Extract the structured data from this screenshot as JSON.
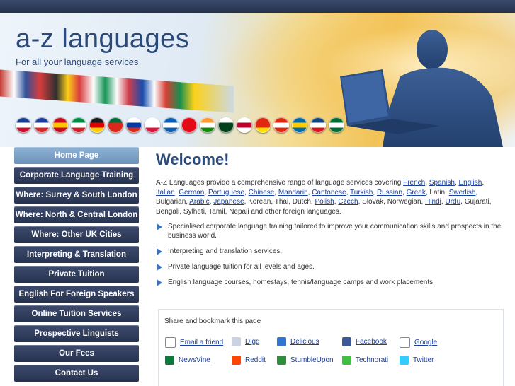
{
  "brand": {
    "title": "a-z languages",
    "tagline": "For all your language services"
  },
  "flags": [
    {
      "name": "uk-flag-icon",
      "colors": [
        "#1a3f8f",
        "#ffffff",
        "#c8102e"
      ]
    },
    {
      "name": "france-flag-icon",
      "colors": [
        "#1f3c99",
        "#ffffff",
        "#d62828"
      ]
    },
    {
      "name": "spain-flag-icon",
      "colors": [
        "#c60b1e",
        "#ffc400",
        "#c60b1e"
      ]
    },
    {
      "name": "italy-flag-icon",
      "colors": [
        "#008c45",
        "#ffffff",
        "#cd212a"
      ]
    },
    {
      "name": "germany-flag-icon",
      "colors": [
        "#1a1a1a",
        "#dd0000",
        "#ffce00"
      ]
    },
    {
      "name": "portugal-flag-icon",
      "colors": [
        "#046a38",
        "#da291c",
        "#da291c"
      ]
    },
    {
      "name": "russia-flag-icon",
      "colors": [
        "#ffffff",
        "#0039a6",
        "#d52b1e"
      ]
    },
    {
      "name": "poland-flag-icon",
      "colors": [
        "#ffffff",
        "#ffffff",
        "#dc143c"
      ]
    },
    {
      "name": "greece-flag-icon",
      "colors": [
        "#0d5eaf",
        "#ffffff",
        "#0d5eaf"
      ]
    },
    {
      "name": "turkey-flag-icon",
      "colors": [
        "#e30a17",
        "#e30a17",
        "#e30a17"
      ]
    },
    {
      "name": "india-flag-icon",
      "colors": [
        "#ff9933",
        "#ffffff",
        "#138808"
      ]
    },
    {
      "name": "pakistan-flag-icon",
      "colors": [
        "#ffffff",
        "#01411c",
        "#01411c"
      ]
    },
    {
      "name": "japan-flag-icon",
      "colors": [
        "#ffffff",
        "#bc002d",
        "#ffffff"
      ]
    },
    {
      "name": "china-flag-icon",
      "colors": [
        "#de2910",
        "#de2910",
        "#ffde00"
      ]
    },
    {
      "name": "hong-kong-flag-icon",
      "colors": [
        "#de2910",
        "#ffffff",
        "#de2910"
      ]
    },
    {
      "name": "sweden-flag-icon",
      "colors": [
        "#006aa7",
        "#fecc00",
        "#006aa7"
      ]
    },
    {
      "name": "czech-flag-icon",
      "colors": [
        "#11457e",
        "#ffffff",
        "#d7141a"
      ]
    },
    {
      "name": "saudi-flag-icon",
      "colors": [
        "#006c35",
        "#ffffff",
        "#006c35"
      ]
    }
  ],
  "nav": {
    "items": [
      {
        "label": "Home Page",
        "active": true
      },
      {
        "label": "Corporate Language Training"
      },
      {
        "label": "Where: Surrey & South London"
      },
      {
        "label": "Where: North & Central London"
      },
      {
        "label": "Where: Other UK Cities"
      },
      {
        "label": "Interpreting & Translation"
      },
      {
        "label": "Private Tuition"
      },
      {
        "label": "English For Foreign Speakers"
      },
      {
        "label": "Online Tuition Services"
      },
      {
        "label": "Prospective Linguists"
      },
      {
        "label": "Our Fees"
      },
      {
        "label": "Contact Us"
      }
    ]
  },
  "main": {
    "heading": "Welcome!",
    "intro": [
      {
        "t": "A-Z Languages provide a comprehensive range of language services covering "
      },
      {
        "t": "French",
        "link": true
      },
      {
        "t": ", "
      },
      {
        "t": "Spanish",
        "link": true
      },
      {
        "t": ", "
      },
      {
        "t": "English",
        "link": true
      },
      {
        "t": ", "
      },
      {
        "t": "Italian",
        "link": true
      },
      {
        "t": ", "
      },
      {
        "t": "German",
        "link": true
      },
      {
        "t": ", "
      },
      {
        "t": "Portuguese",
        "link": true
      },
      {
        "t": ", "
      },
      {
        "t": "Chinese",
        "link": true
      },
      {
        "t": ", "
      },
      {
        "t": "Mandarin",
        "link": true
      },
      {
        "t": ", "
      },
      {
        "t": "Cantonese",
        "link": true
      },
      {
        "t": ", "
      },
      {
        "t": "Turkish",
        "link": true
      },
      {
        "t": ", "
      },
      {
        "t": "Russian",
        "link": true
      },
      {
        "t": ", "
      },
      {
        "t": "Greek",
        "link": true
      },
      {
        "t": ", Latin, "
      },
      {
        "t": "Swedish",
        "link": true
      },
      {
        "t": ", Bulgarian, "
      },
      {
        "t": "Arabic",
        "link": true
      },
      {
        "t": ", "
      },
      {
        "t": "Japanese",
        "link": true
      },
      {
        "t": ", Korean, Thai, Dutch, "
      },
      {
        "t": "Polish",
        "link": true
      },
      {
        "t": ", "
      },
      {
        "t": "Czech",
        "link": true
      },
      {
        "t": ", Slovak, Norwegian, "
      },
      {
        "t": "Hindi",
        "link": true
      },
      {
        "t": ", "
      },
      {
        "t": "Urdu",
        "link": true
      },
      {
        "t": ", Gujarati, Bengali, Sylheti, Tamil, Nepali and other foreign languages."
      }
    ],
    "bullets": [
      "Specialised corporate language training tailored to improve your communication skills and prospects in the business world.",
      "Interpreting and translation services.",
      "Private language tuition for all levels and ages.",
      "English language courses, homestays, tennis/language camps and work placements."
    ]
  },
  "share": {
    "title": "Share and bookmark this page",
    "links": [
      {
        "label": "Email a friend",
        "icon": "envelope-icon",
        "color": "#ffffff"
      },
      {
        "label": "Digg",
        "icon": "digg-icon",
        "color": "#c8d4e4"
      },
      {
        "label": "Delicious",
        "icon": "delicious-icon",
        "color": "#3274d1"
      },
      {
        "label": "Facebook",
        "icon": "facebook-icon",
        "color": "#3b5998"
      },
      {
        "label": "Google",
        "icon": "google-icon",
        "color": "#ffffff"
      },
      {
        "label": "NewsVine",
        "icon": "newsvine-icon",
        "color": "#0b7a3b"
      },
      {
        "label": "Reddit",
        "icon": "reddit-icon",
        "color": "#ff4500"
      },
      {
        "label": "StumbleUpon",
        "icon": "stumbleupon-icon",
        "color": "#2f8d3c"
      },
      {
        "label": "Technorati",
        "icon": "technorati-icon",
        "color": "#3fbf3f"
      },
      {
        "label": "Twitter",
        "icon": "twitter-icon",
        "color": "#33ccff"
      }
    ]
  },
  "colors": {
    "brand": "#2c4a78",
    "nav": "#2c3958",
    "nav_active": "#7ea4c8",
    "link": "#1a3f9e",
    "bullet": "#3a72c2"
  }
}
